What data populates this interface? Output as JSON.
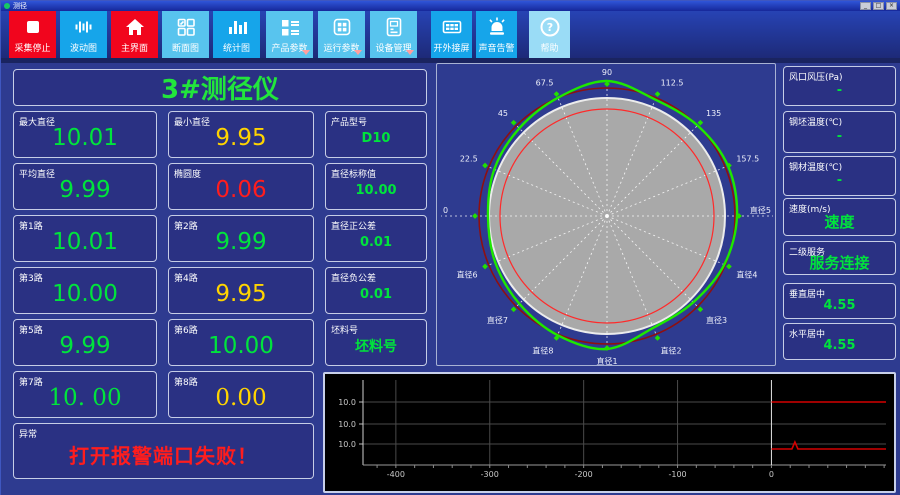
{
  "window": {
    "title": "测径",
    "controls": [
      "_",
      "□",
      "×"
    ]
  },
  "toolbar": {
    "buttons": [
      {
        "label": "采集停止",
        "style": "red",
        "icon": "stop"
      },
      {
        "label": "波动图",
        "style": "blue",
        "icon": "waveform"
      },
      {
        "label": "主界面",
        "style": "red",
        "icon": "home"
      },
      {
        "label": "断面图",
        "style": "lightblue",
        "icon": "section"
      },
      {
        "label": "统计图",
        "style": "blue",
        "icon": "barchart"
      },
      {
        "label": "产品参数",
        "style": "lightblue",
        "icon": "product-params",
        "dropdown": true
      },
      {
        "label": "运行参数",
        "style": "lightblue",
        "icon": "run-params",
        "dropdown": true
      },
      {
        "label": "设备管理",
        "style": "lightblue",
        "icon": "device",
        "dropdown": true
      },
      {
        "label": "开外接屏",
        "style": "blue",
        "icon": "monitor"
      },
      {
        "label": "声音告警",
        "style": "blue",
        "icon": "alarm"
      },
      {
        "label": "帮助",
        "style": "pale",
        "icon": "help"
      }
    ]
  },
  "panel": {
    "title": "3#测径仪"
  },
  "metrics": {
    "cells": [
      {
        "label": "最大直径",
        "value": "10.01",
        "row": 1,
        "col": 1,
        "color": "green",
        "size": "lg"
      },
      {
        "label": "最小直径",
        "value": "9.95",
        "row": 1,
        "col": 2,
        "color": "yellow",
        "size": "lg"
      },
      {
        "label": "产品型号",
        "value": "D10",
        "row": 1,
        "col": 3,
        "color": "green",
        "size": "sm"
      },
      {
        "label": "平均直径",
        "value": "9.99",
        "row": 2,
        "col": 1,
        "color": "green",
        "size": "lg"
      },
      {
        "label": "椭圆度",
        "value": "0.06",
        "row": 2,
        "col": 2,
        "color": "red",
        "size": "lg"
      },
      {
        "label": "直径标称值",
        "value": "10.00",
        "row": 2,
        "col": 3,
        "color": "green",
        "size": "sm"
      },
      {
        "label": "第1路",
        "value": "10.01",
        "row": 3,
        "col": 1,
        "color": "green",
        "size": "lg"
      },
      {
        "label": "第2路",
        "value": "9.99",
        "row": 3,
        "col": 2,
        "color": "green",
        "size": "lg"
      },
      {
        "label": "直径正公差",
        "value": "0.01",
        "row": 3,
        "col": 3,
        "color": "green",
        "size": "sm"
      },
      {
        "label": "第3路",
        "value": "10.00",
        "row": 4,
        "col": 1,
        "color": "green",
        "size": "lg"
      },
      {
        "label": "第4路",
        "value": "9.95",
        "row": 4,
        "col": 2,
        "color": "yellow",
        "size": "lg"
      },
      {
        "label": "直径负公差",
        "value": "0.01",
        "row": 4,
        "col": 3,
        "color": "green",
        "size": "sm"
      },
      {
        "label": "第5路",
        "value": "9.99",
        "row": 5,
        "col": 1,
        "color": "green",
        "size": "lg"
      },
      {
        "label": "第6路",
        "value": "10.00",
        "row": 5,
        "col": 2,
        "color": "green",
        "size": "lg"
      },
      {
        "label": "坯料号",
        "value": "坯料号",
        "row": 5,
        "col": 3,
        "color": "green",
        "size": "sm2"
      },
      {
        "label": "第7路",
        "value": "10. 00",
        "row": 6,
        "col": 1,
        "color": "green",
        "size": "lg",
        "serif": true
      },
      {
        "label": "第8路",
        "value": "0.00",
        "row": 6,
        "col": 2,
        "color": "yellow",
        "size": "lg",
        "serif": true
      },
      {
        "label": "异常",
        "value": "打开报警端口失败！",
        "row": 7,
        "col": 1,
        "span": 2,
        "color": "red",
        "size": "alarm"
      }
    ]
  },
  "right_panel": {
    "boxes": [
      {
        "label": "风口风压(Pa)",
        "value": "-"
      },
      {
        "label": "钢坯温度(℃)",
        "value": "-"
      },
      {
        "label": "钢材温度(℃)",
        "value": "-"
      },
      {
        "label": "速度(m/s)",
        "value": "速度"
      },
      {
        "label": "二级服务",
        "value": "服务连接"
      },
      {
        "label": "垂直居中",
        "value": "4.55"
      },
      {
        "label": "水平居中",
        "value": "4.55"
      }
    ]
  },
  "chart_data": [
    {
      "name": "cross-section-polar",
      "type": "polar-profile",
      "disc_radius": 118,
      "outer_circle_radius": 128,
      "inner_circle_radius": 107,
      "colors": {
        "disc": "#a9a9a9",
        "disc_rim": "#ececec",
        "outer": "#8f0f10",
        "inner": "#ff2a2a",
        "profile": "#1ee800",
        "spokes": "#ffffff",
        "label": "#eef0fa",
        "marker": "#22e000"
      },
      "labels": [
        {
          "a": 180,
          "t": "0"
        },
        {
          "a": 157.5,
          "t": "22.5"
        },
        {
          "a": 135,
          "t": "45"
        },
        {
          "a": 112.5,
          "t": "67.5"
        },
        {
          "a": 90,
          "t": "90"
        },
        {
          "a": 67.5,
          "t": "112.5"
        },
        {
          "a": 45,
          "t": "135"
        },
        {
          "a": 22.5,
          "t": "157.5"
        },
        {
          "a": 0,
          "t": "直径5"
        },
        {
          "a": 337.5,
          "t": "直径4"
        },
        {
          "a": 315,
          "t": "直径3"
        },
        {
          "a": 292.5,
          "t": "直径2"
        },
        {
          "a": 270,
          "t": "直径1"
        },
        {
          "a": 247.5,
          "t": "直径8"
        },
        {
          "a": 225,
          "t": "直径7"
        },
        {
          "a": 202.5,
          "t": "直径6"
        }
      ],
      "profile": [
        {
          "a": 0,
          "r": 130
        },
        {
          "a": 22.5,
          "r": 131
        },
        {
          "a": 45,
          "r": 128
        },
        {
          "a": 67.5,
          "r": 126
        },
        {
          "a": 90,
          "r": 135
        },
        {
          "a": 112.5,
          "r": 128
        },
        {
          "a": 135,
          "r": 124
        },
        {
          "a": 157.5,
          "r": 122
        },
        {
          "a": 180,
          "r": 119
        },
        {
          "a": 202.5,
          "r": 121
        },
        {
          "a": 225,
          "r": 124
        },
        {
          "a": 247.5,
          "r": 129
        },
        {
          "a": 270,
          "r": 133
        },
        {
          "a": 292.5,
          "r": 121
        },
        {
          "a": 315,
          "r": 122
        },
        {
          "a": 337.5,
          "r": 127
        }
      ]
    },
    {
      "name": "diameter-trend",
      "type": "line",
      "bg": "#000000",
      "x_ticks": [
        -400,
        -300,
        -200,
        -100,
        0
      ],
      "x_range": [
        -435,
        122
      ],
      "y_tick_labels": [
        "10.0",
        "10.0",
        "10.0"
      ],
      "grid_color": "#4a4a4a",
      "zero_line_x": 0,
      "series": [
        {
          "name": "red-line-upper",
          "color": "#d40000",
          "x_from": 0,
          "x_to": 122,
          "grid_level": 0,
          "offset": 0
        },
        {
          "name": "red-line-lower",
          "color": "#d40000",
          "x_from": 0,
          "x_to": 122,
          "grid_level": 2,
          "offset": 5,
          "spike_x": 25,
          "spike_h": 7
        }
      ]
    }
  ]
}
